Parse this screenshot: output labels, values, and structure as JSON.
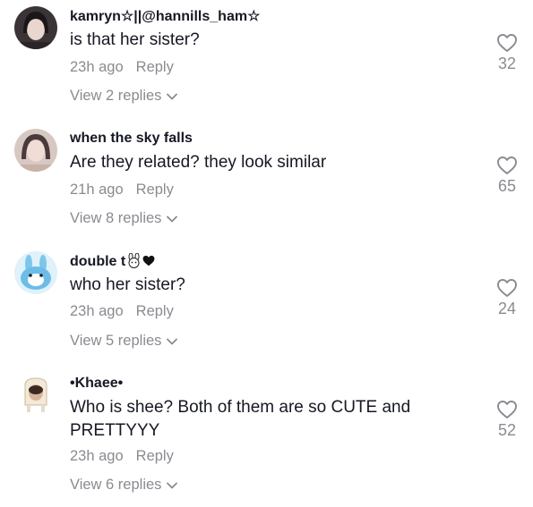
{
  "comments": [
    {
      "username": "kamryn☆||@hannills_ham☆",
      "text": "is that her sister?",
      "time": "23h ago",
      "reply": "Reply",
      "view_replies": "View 2 replies",
      "likes": "32",
      "avatar_icon": "girl-avatar-icon"
    },
    {
      "username": "when the sky falls",
      "text": "Are they related? they look similar",
      "time": "21h ago",
      "reply": "Reply",
      "view_replies": "View 8 replies",
      "likes": "65",
      "avatar_icon": "girl-avatar-icon"
    },
    {
      "username": "double t",
      "username_emoji": "bunny-emoji heart-emoji",
      "text": "who her sister?",
      "time": "23h ago",
      "reply": "Reply",
      "view_replies": "View 5 replies",
      "likes": "24",
      "avatar_icon": "blue-bunny-plush-avatar-icon"
    },
    {
      "username": "•Khaee•",
      "text": "Who is shee? Both of them are so CUTE and PRETTYYY",
      "time": "23h ago",
      "reply": "Reply",
      "view_replies": "View 6 replies",
      "likes": "52",
      "avatar_icon": "toast-character-avatar-icon"
    }
  ],
  "colors": {
    "text_primary": "#161823",
    "text_secondary": "#8a8b91",
    "background": "#ffffff"
  }
}
